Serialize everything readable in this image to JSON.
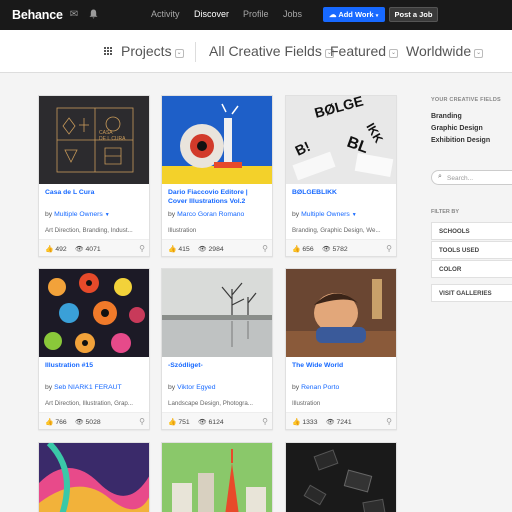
{
  "header": {
    "logo": "Behance",
    "nav": [
      "Activity",
      "Discover",
      "Profile",
      "Jobs"
    ],
    "active_nav": "Discover",
    "add_work": "Add Work",
    "post_job": "Post a Job",
    "accent": "#1769ff"
  },
  "filters": {
    "projects": "Projects",
    "fields": "All Creative Fields",
    "featured": "Featured",
    "location": "Worldwide"
  },
  "cards": [
    {
      "title": "Casa de L Cura",
      "by": "by",
      "owner": "Multiple Owners",
      "fields": "Art Direction, Branding, Indust...",
      "likes": "492",
      "views": "4071"
    },
    {
      "title": "Dario Fiaccovio Editore | Cover Illustrations Vol.2",
      "by": "by",
      "owner": "Marco Goran Romano",
      "fields": "Illustration",
      "likes": "415",
      "views": "2984"
    },
    {
      "title": "BØLGEBLIKK",
      "by": "by",
      "owner": "Multiple Owners",
      "fields": "Branding, Graphic Design, We...",
      "likes": "656",
      "views": "5782"
    },
    {
      "title": "Illustration #15",
      "by": "by",
      "owner": "Seb NIARK1 FERAUT",
      "fields": "Art Direction, Illustration, Grap...",
      "likes": "766",
      "views": "5028"
    },
    {
      "title": "-Szódliget-",
      "by": "by",
      "owner": "Viktor Egyed",
      "fields": "Landscape Design, Photogra...",
      "likes": "751",
      "views": "6124"
    },
    {
      "title": "The Wide World",
      "by": "by",
      "owner": "Renan Porto",
      "fields": "Illustration",
      "likes": "1333",
      "views": "7241"
    }
  ],
  "sidebar": {
    "your_fields_heading": "YOUR CREATIVE FIELDS",
    "fields": [
      "Branding",
      "Graphic Design",
      "Exhibition Design"
    ],
    "search_placeholder": "Search...",
    "filter_by": "FILTER BY",
    "filter_options": [
      "SCHOOLS",
      "TOOLS USED",
      "COLOR"
    ],
    "visit_galleries": "VISIT GALLERIES"
  }
}
